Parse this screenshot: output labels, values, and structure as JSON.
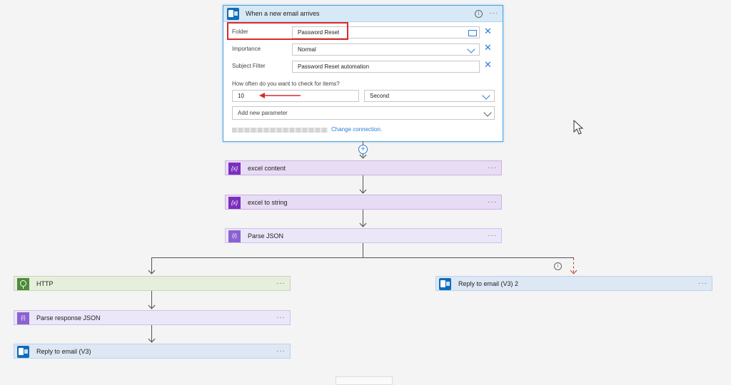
{
  "trigger": {
    "title": "When a new email arrives",
    "folder_label": "Folder",
    "folder_value": "Password Reset",
    "importance_label": "Importance",
    "importance_value": "Normal",
    "subject_label": "Subject Filter",
    "subject_value": "Password Reset automation",
    "frequency_question": "How often do you want to check for items?",
    "interval_value": "10",
    "unit_value": "Second",
    "add_parameter": "Add new parameter",
    "change_connection": "Change connection."
  },
  "steps": {
    "excel_content": "excel content",
    "excel_to_string": "excel to string",
    "parse_json": "Parse JSON",
    "http": "HTTP",
    "parse_response_json": "Parse response JSON",
    "reply_to_email": "Reply to email (V3)",
    "reply_to_email_2": "Reply to email (V3) 2"
  },
  "icons": {
    "variable_glyph": "{x}",
    "json_glyph": "{/}",
    "dots": "···",
    "info": "i",
    "close": "✕",
    "plus": "+"
  },
  "colors": {
    "accent": "#2b7cd3",
    "annotation_red": "#d92b2b",
    "variable": "#7b2fbe",
    "json": "#8a63d2",
    "http": "#4e8a3a",
    "outlook": "#0f6cbd"
  }
}
